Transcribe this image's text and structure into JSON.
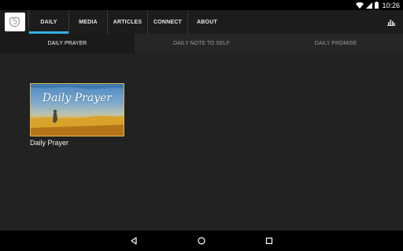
{
  "status": {
    "time": "10:26"
  },
  "nav": {
    "tabs": [
      {
        "label": "DAILY",
        "active": true
      },
      {
        "label": "MEDIA"
      },
      {
        "label": "ARTICLES"
      },
      {
        "label": "CONNECT"
      },
      {
        "label": "ABOUT"
      }
    ]
  },
  "sub_tabs": [
    {
      "label": "DAILY PRAYER",
      "active": true
    },
    {
      "label": "DAILY NOTE TO SELF"
    },
    {
      "label": "DAILY PROMISE"
    }
  ],
  "content": {
    "cards": [
      {
        "image_text": "Daily Prayer",
        "title": "Daily Prayer"
      }
    ]
  },
  "icons": {
    "logo": "logo-icon",
    "chart": "bar-chart-icon",
    "wifi": "wifi-icon",
    "signal": "signal-icon",
    "battery": "battery-icon",
    "back": "back-icon",
    "home": "home-icon",
    "recents": "recents-icon"
  },
  "colors": {
    "accent": "#35b0e8",
    "background": "#222222",
    "card_border": "#d8b84a"
  }
}
